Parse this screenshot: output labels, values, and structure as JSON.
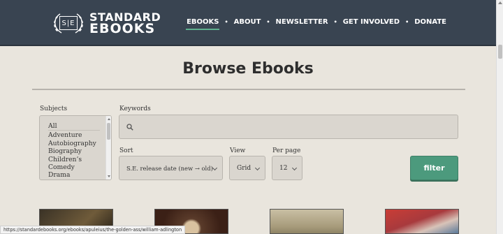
{
  "header": {
    "logo_box": "S|E",
    "logo_line1": "STANDARD",
    "logo_line2": "EBOOKS",
    "nav": [
      {
        "label": "EBOOKS",
        "active": true
      },
      {
        "label": "ABOUT",
        "active": false
      },
      {
        "label": "NEWSLETTER",
        "active": false
      },
      {
        "label": "GET INVOLVED",
        "active": false
      },
      {
        "label": "DONATE",
        "active": false
      }
    ],
    "separator": "•"
  },
  "page_title": "Browse Ebooks",
  "filters": {
    "subjects_label": "Subjects",
    "subjects": [
      "All",
      "Adventure",
      "Autobiography",
      "Biography",
      "Children’s",
      "Comedy",
      "Drama"
    ],
    "keywords_label": "Keywords",
    "keywords_value": "",
    "sort_label": "Sort",
    "sort_value": "S.E. release date (new → old)",
    "view_label": "View",
    "view_value": "Grid",
    "per_page_label": "Per page",
    "per_page_value": "12",
    "filter_button": "filter"
  },
  "status_bar": "https://standardebooks.org/ebooks/apuleius/the-golden-ass/william-adlington",
  "icons": {
    "search": "search-icon",
    "chevron": "chevron-down-icon",
    "wreath": "laurel-wreath-icon"
  },
  "colors": {
    "header_bg": "#394451",
    "page_bg": "#e9e5dd",
    "accent": "#4c9a7d"
  }
}
